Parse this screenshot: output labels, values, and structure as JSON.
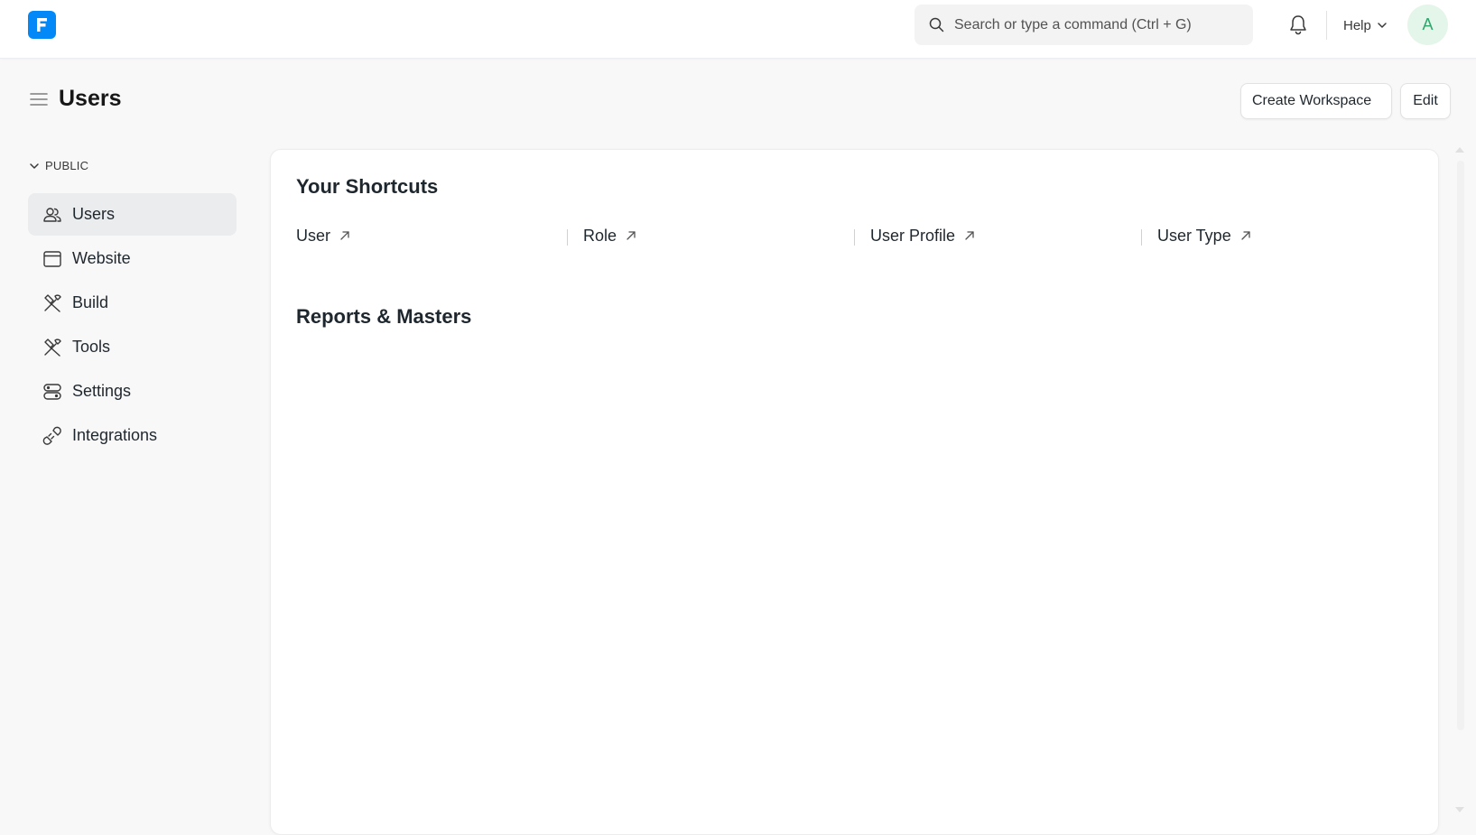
{
  "navbar": {
    "logo_letter": "F",
    "search": {
      "placeholder": "Search or type a command (Ctrl + G)",
      "value": ""
    },
    "help_label": "Help",
    "avatar_initial": "A"
  },
  "page": {
    "title": "Users",
    "create_workspace_label": "Create Workspace",
    "edit_label": "Edit"
  },
  "sidebar": {
    "section_label": "PUBLIC",
    "items": [
      {
        "label": "Users",
        "icon": "users-icon",
        "active": true
      },
      {
        "label": "Website",
        "icon": "website-icon",
        "active": false
      },
      {
        "label": "Build",
        "icon": "build-icon",
        "active": false
      },
      {
        "label": "Tools",
        "icon": "tools-icon",
        "active": false
      },
      {
        "label": "Settings",
        "icon": "settings-icon",
        "active": false
      },
      {
        "label": "Integrations",
        "icon": "integrations-icon",
        "active": false
      }
    ]
  },
  "main": {
    "shortcuts_heading": "Your Shortcuts",
    "shortcuts": [
      {
        "label": "User"
      },
      {
        "label": "Role"
      },
      {
        "label": "User Profile"
      },
      {
        "label": "User Type"
      }
    ],
    "reports_heading": "Reports & Masters"
  },
  "colors": {
    "brand": "#0289f7",
    "active_item_bg": "#ebecee",
    "avatar_bg": "#e4f5e9",
    "avatar_text": "#30a66d"
  }
}
